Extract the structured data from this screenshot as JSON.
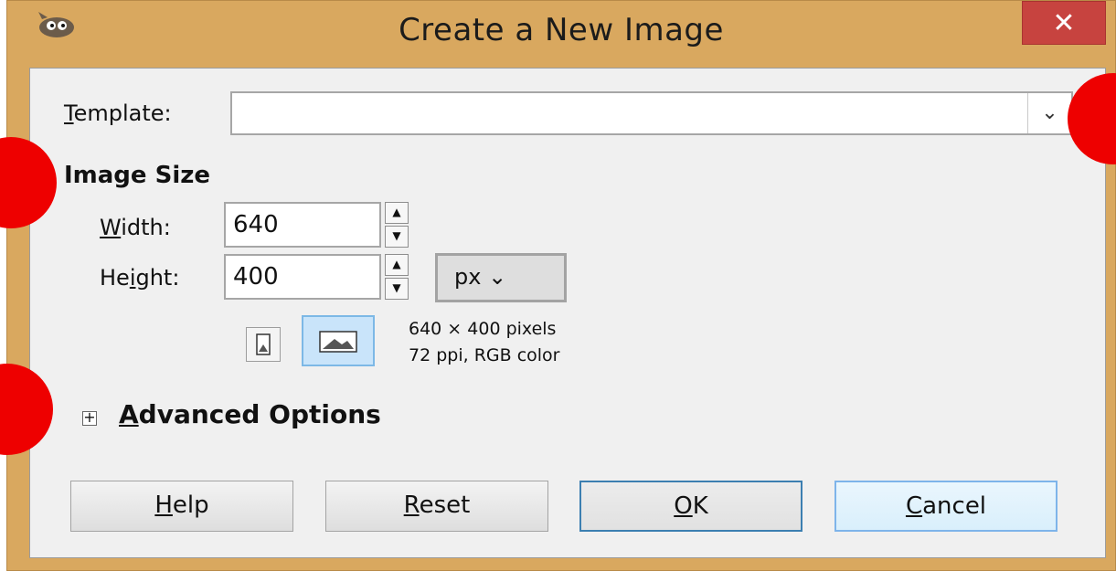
{
  "window": {
    "title": "Create a New Image",
    "close_symbol": "✕",
    "app_icon": "gimp-wilber-icon"
  },
  "template": {
    "label_first": "T",
    "label_rest": "emplate:",
    "value": ""
  },
  "image_size": {
    "title": "Image Size",
    "width": {
      "label_first": "W",
      "label_rest": "idth:",
      "value": "640"
    },
    "height": {
      "label_pre": "He",
      "label_mid": "i",
      "label_rest": "ght:",
      "value": "400"
    },
    "unit": "px",
    "info_line1": "640 × 400 pixels",
    "info_line2": "72 ppi, RGB color"
  },
  "advanced": {
    "expander": "+",
    "label_first": "A",
    "label_rest": "dvanced Options"
  },
  "buttons": {
    "help": {
      "first": "H",
      "rest": "elp"
    },
    "reset": {
      "first": "R",
      "rest": "eset"
    },
    "ok": {
      "first": "O",
      "rest": "K"
    },
    "cancel": {
      "first": "C",
      "rest": "ancel"
    }
  },
  "colors": {
    "window_frame": "#d9a85f",
    "close": "#c7433f",
    "marker": "#ee0000"
  }
}
